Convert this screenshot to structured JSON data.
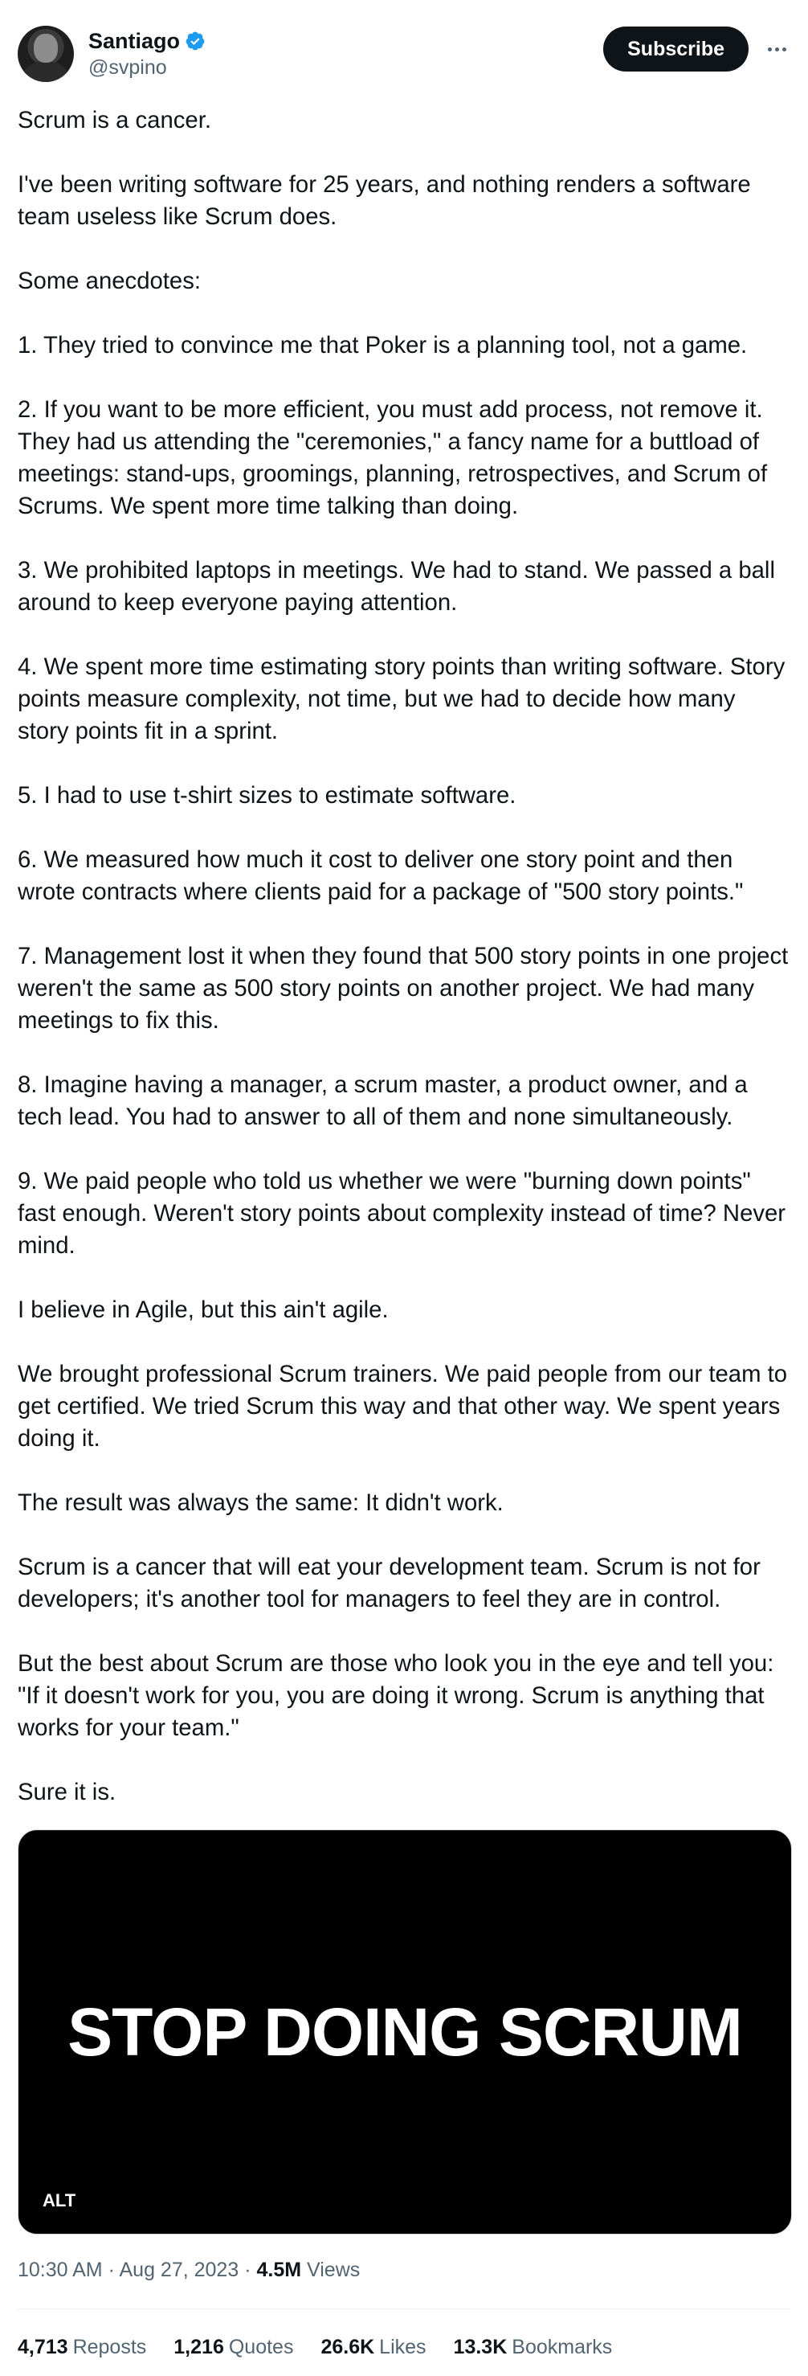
{
  "author": {
    "name": "Santiago",
    "handle": "@svpino",
    "verified_color": "#1d9bf0"
  },
  "actions": {
    "subscribe_label": "Subscribe",
    "more_icon": "more-horizontal-icon"
  },
  "tweet": {
    "paragraphs": [
      "Scrum is a cancer.",
      "I've been writing software for 25 years, and nothing renders a software team useless like Scrum does.",
      "Some anecdotes:",
      "1. They tried to convince me that Poker is a planning tool, not a game.",
      "2. If you want to be more efficient, you must add process, not remove it. They had us attending the \"ceremonies,\" a fancy name for a buttload of meetings: stand-ups, groomings, planning, retrospectives, and Scrum of Scrums. We spent more time talking than doing.",
      "3. We prohibited laptops in meetings. We had to stand. We passed a ball around to keep everyone paying attention.",
      "4. We spent more time estimating story points than writing software. Story points measure complexity, not time, but we had to decide how many story points fit in a sprint.",
      "5. I had to use t-shirt sizes to estimate software.",
      "6. We measured how much it cost to deliver one story point and then wrote contracts where clients paid for a package of \"500 story points.\"",
      "7. Management lost it when they found that 500 story points in one project weren't the same as 500 story points on another project. We had many meetings to fix this.",
      "8. Imagine having a manager, a scrum master, a product owner, and a tech lead. You had to answer to all of them and none simultaneously.",
      "9. We paid people who told us whether we were \"burning down points\" fast enough. Weren't story points about complexity instead of time? Never mind.",
      "I believe in Agile, but this ain't agile.",
      "We brought professional Scrum trainers. We paid people from our team to get certified. We tried Scrum this way and that other way. We spent years doing it.",
      "The result was always the same: It didn't work.",
      "Scrum is a cancer that will eat your development team. Scrum is not for developers; it's another tool for managers to feel they are in control.",
      "But the best about Scrum are those who look you in the eye and tell you: \"If it doesn't work for you, you are doing it wrong. Scrum is anything that works for your team.\"",
      "Sure it is."
    ]
  },
  "media": {
    "text": "STOP DOING SCRUM",
    "alt_label": "ALT"
  },
  "meta": {
    "time": "10:30 AM",
    "separator": "·",
    "date": "Aug 27, 2023",
    "views_count": "4.5M",
    "views_label": "Views"
  },
  "stats": [
    {
      "count": "4,713",
      "label": "Reposts"
    },
    {
      "count": "1,216",
      "label": "Quotes"
    },
    {
      "count": "26.6K",
      "label": "Likes"
    },
    {
      "count": "13.3K",
      "label": "Bookmarks"
    }
  ]
}
